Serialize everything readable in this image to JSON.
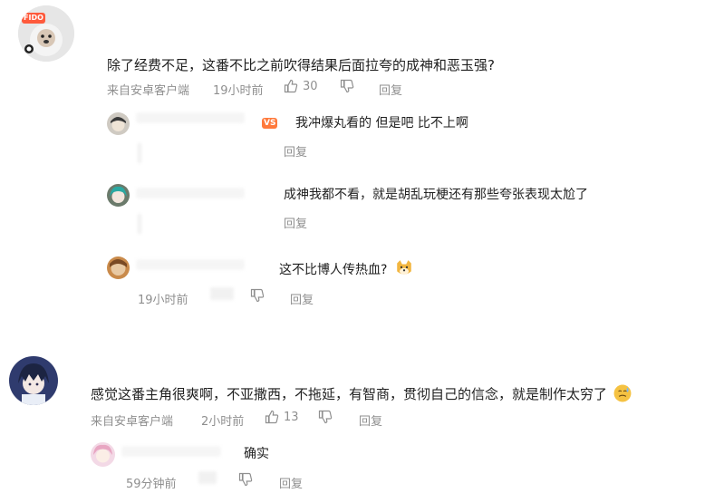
{
  "comments": [
    {
      "text": "除了经费不足，这番不比之前吹得结果后面拉夸的成神和恶玉强?",
      "source": "来自安卓客户端",
      "time": "19小时前",
      "likes": "30",
      "reply_label": "回复",
      "replies": [
        {
          "text": "我冲爆丸看的 但是吧 比不上啊",
          "reply_label": "回复",
          "badge": "VS"
        },
        {
          "text": "成神我都不看，就是胡乱玩梗还有那些夸张表现太尬了",
          "reply_label": "回复"
        },
        {
          "text": "这不比博人传热血?",
          "time": "19小时前",
          "reply_label": "回复"
        }
      ]
    },
    {
      "text": "感觉这番主角很爽啊，不亚撒西，不拖延，有智商，贯彻自己的信念，就是制作太穷了",
      "source": "来自安卓客户端",
      "time": "2小时前",
      "likes": "13",
      "reply_label": "回复",
      "replies": [
        {
          "text": "确实",
          "time": "59分钟前",
          "reply_label": "回复"
        }
      ]
    }
  ],
  "avatar_badge": "FIDO",
  "icons": [
    "thumbs-up-icon",
    "thumbs-down-icon",
    "dog-emoji-icon",
    "sweat-emoji-icon"
  ],
  "colors": {
    "meta": "#8f8f8f",
    "text": "#1f1f1f",
    "badge": "#ff5a3c",
    "background": "#ffffff"
  }
}
